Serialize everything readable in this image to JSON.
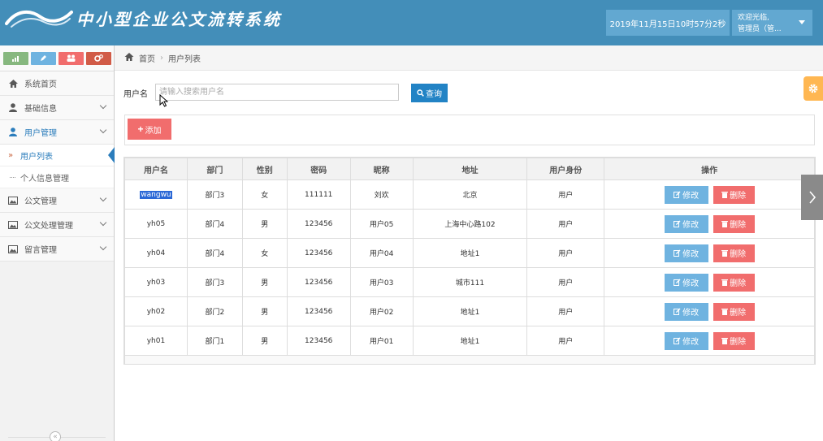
{
  "header": {
    "title": "中小型企业公文流转系统",
    "datetime": "2019年11月15日10时57分2秒",
    "welcome": "欢迎光临,",
    "user": "管理员（管..."
  },
  "sidebar": {
    "items": [
      {
        "label": "系统首页",
        "icon": "home-icon"
      },
      {
        "label": "基础信息",
        "icon": "user-icon"
      },
      {
        "label": "用户管理",
        "icon": "user-icon"
      },
      {
        "label": "公文管理",
        "icon": "picture-icon"
      },
      {
        "label": "公文处理管理",
        "icon": "picture-icon"
      },
      {
        "label": "留言管理",
        "icon": "picture-icon"
      }
    ],
    "sub_items": [
      "用户列表",
      "个人信息管理"
    ],
    "collapse": "«"
  },
  "breadcrumb": {
    "home": "首页",
    "current": "用户列表"
  },
  "search": {
    "label": "用户名",
    "placeholder": "请输入搜索用户名",
    "button": "查询"
  },
  "add_button": "添加",
  "table": {
    "headers": [
      "用户名",
      "部门",
      "性别",
      "密码",
      "昵称",
      "地址",
      "用户身份",
      "操作"
    ],
    "rows": [
      [
        "wangwu",
        "部门3",
        "女",
        "111111",
        "刘欢",
        "北京",
        "用户"
      ],
      [
        "yh05",
        "部门4",
        "男",
        "123456",
        "用户05",
        "上海中心路102",
        "用户"
      ],
      [
        "yh04",
        "部门4",
        "女",
        "123456",
        "用户04",
        "地址1",
        "用户"
      ],
      [
        "yh03",
        "部门3",
        "男",
        "123456",
        "用户03",
        "城市111",
        "用户"
      ],
      [
        "yh02",
        "部门2",
        "男",
        "123456",
        "用户02",
        "地址1",
        "用户"
      ],
      [
        "yh01",
        "部门1",
        "男",
        "123456",
        "用户01",
        "地址1",
        "用户"
      ]
    ],
    "edit_label": "修改",
    "delete_label": "删除"
  },
  "colors": {
    "header": "#438eb9",
    "primary": "#2283c5",
    "edit": "#6fb3e0",
    "danger": "#f16d6d",
    "warning": "#ffb752"
  }
}
